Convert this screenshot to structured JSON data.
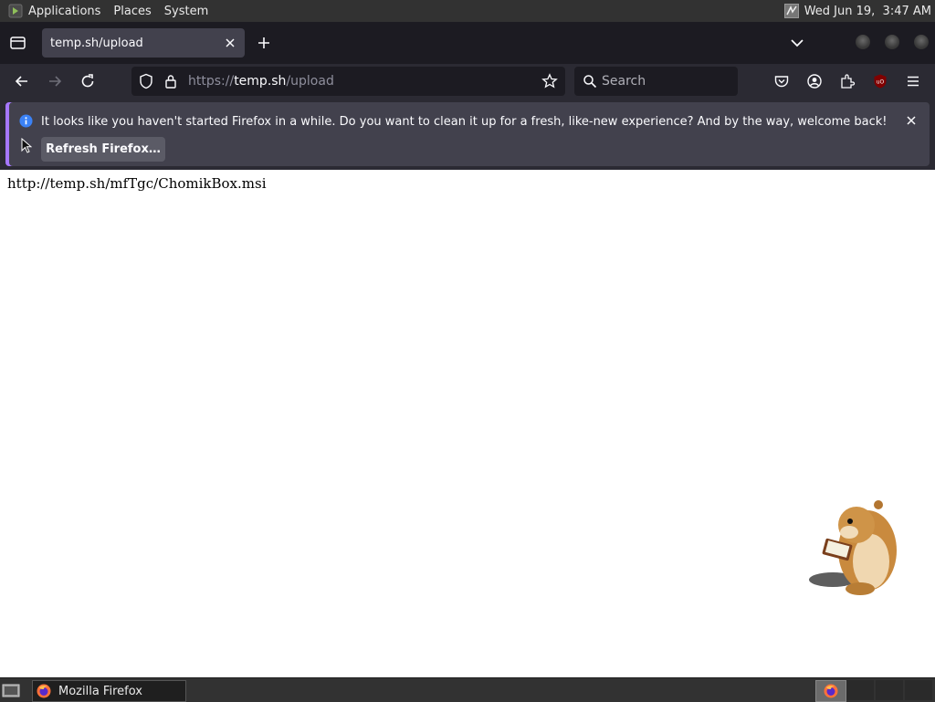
{
  "system_panel": {
    "menus": [
      "Applications",
      "Places",
      "System"
    ],
    "clock": "Wed Jun 19,  3:47 AM"
  },
  "browser": {
    "tab": {
      "title": "temp.sh/upload"
    },
    "url": {
      "scheme": "https://",
      "host": "temp.sh",
      "path": "/upload"
    },
    "search_placeholder": "Search",
    "notification": {
      "message": "It looks like you haven't started Firefox in a while. Do you want to clean it up for a fresh, like-new experience? And by the way, welcome back!",
      "button_label": "Refresh Firefox…"
    }
  },
  "page": {
    "content_text": "http://temp.sh/mfTgc/ChomikBox.msi"
  },
  "taskbar": {
    "window_label": "Mozilla Firefox"
  },
  "colors": {
    "accent": "#a677ff",
    "toolbar": "#2b2a33",
    "tabstrip": "#1c1b22",
    "panel": "#323232"
  },
  "icons": [
    "distro-logo-icon",
    "network-icon",
    "tab-list-icon",
    "close-icon",
    "plus-icon",
    "chevron-down-icon",
    "back-arrow-icon",
    "forward-arrow-icon",
    "reload-icon",
    "shield-icon",
    "lock-icon",
    "star-icon",
    "search-icon",
    "pocket-icon",
    "account-icon",
    "extensions-icon",
    "ublock-icon",
    "hamburger-menu-icon",
    "info-icon",
    "firefox-icon"
  ]
}
